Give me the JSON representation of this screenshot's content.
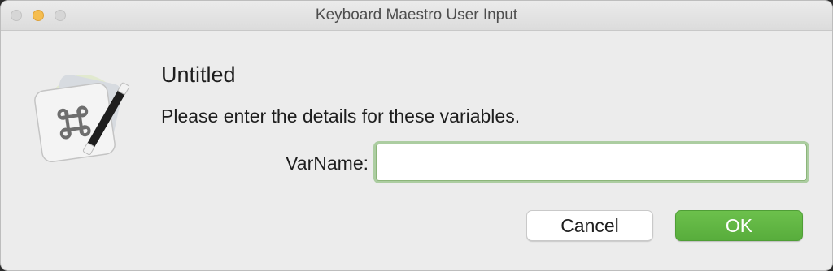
{
  "window": {
    "title": "Keyboard Maestro User Input"
  },
  "dialog": {
    "heading": "Untitled",
    "message": "Please enter the details for these variables.",
    "icon": "keyboard-maestro-app-icon"
  },
  "form": {
    "fields": [
      {
        "label": "VarName:",
        "value": "",
        "placeholder": ""
      }
    ]
  },
  "buttons": {
    "cancel_label": "Cancel",
    "ok_label": "OK"
  },
  "colors": {
    "accent": "#5fb443",
    "focus_ring": "#8cb57a",
    "window_bg": "#ececec"
  }
}
